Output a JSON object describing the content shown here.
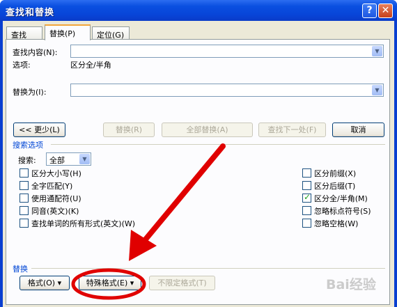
{
  "window": {
    "title": "查找和替换",
    "help_label": "?",
    "close_label": "✕"
  },
  "tabs": [
    {
      "label": "查找(D)"
    },
    {
      "label": "替换(P)"
    },
    {
      "label": "定位(G)"
    }
  ],
  "find": {
    "label": "查找内容(N):",
    "value": "",
    "options_label": "选项:",
    "options_value": "区分全/半角"
  },
  "replace": {
    "label": "替换为(I):",
    "value": ""
  },
  "buttons": {
    "less": "<< 更少(L)",
    "replace": "替换(R)",
    "replace_all": "全部替换(A)",
    "find_next": "查找下一处(F)",
    "cancel": "取消"
  },
  "search_options": {
    "title": "搜索选项",
    "search_label": "搜索:",
    "search_value": "全部",
    "left": [
      {
        "label": "区分大小写(H)",
        "checked": false
      },
      {
        "label": "全字匹配(Y)",
        "checked": false
      },
      {
        "label": "使用通配符(U)",
        "checked": false
      },
      {
        "label": "同音(英文)(K)",
        "checked": false
      },
      {
        "label": "查找单词的所有形式(英文)(W)",
        "checked": false
      }
    ],
    "right": [
      {
        "label": "区分前缀(X)",
        "checked": false
      },
      {
        "label": "区分后缀(T)",
        "checked": false
      },
      {
        "label": "区分全/半角(M)",
        "checked": true
      },
      {
        "label": "忽略标点符号(S)",
        "checked": false
      },
      {
        "label": "忽略空格(W)",
        "checked": false
      }
    ]
  },
  "replace_section": {
    "title": "替换",
    "format": "格式(O) ▾",
    "special": "特殊格式(E) ▾",
    "no_format": "不限定格式(T)"
  },
  "watermark": {
    "text": "Bai经验"
  },
  "annotation_color": "#e00000",
  "check_mark": "✓",
  "dropdown_arrow": "▼"
}
